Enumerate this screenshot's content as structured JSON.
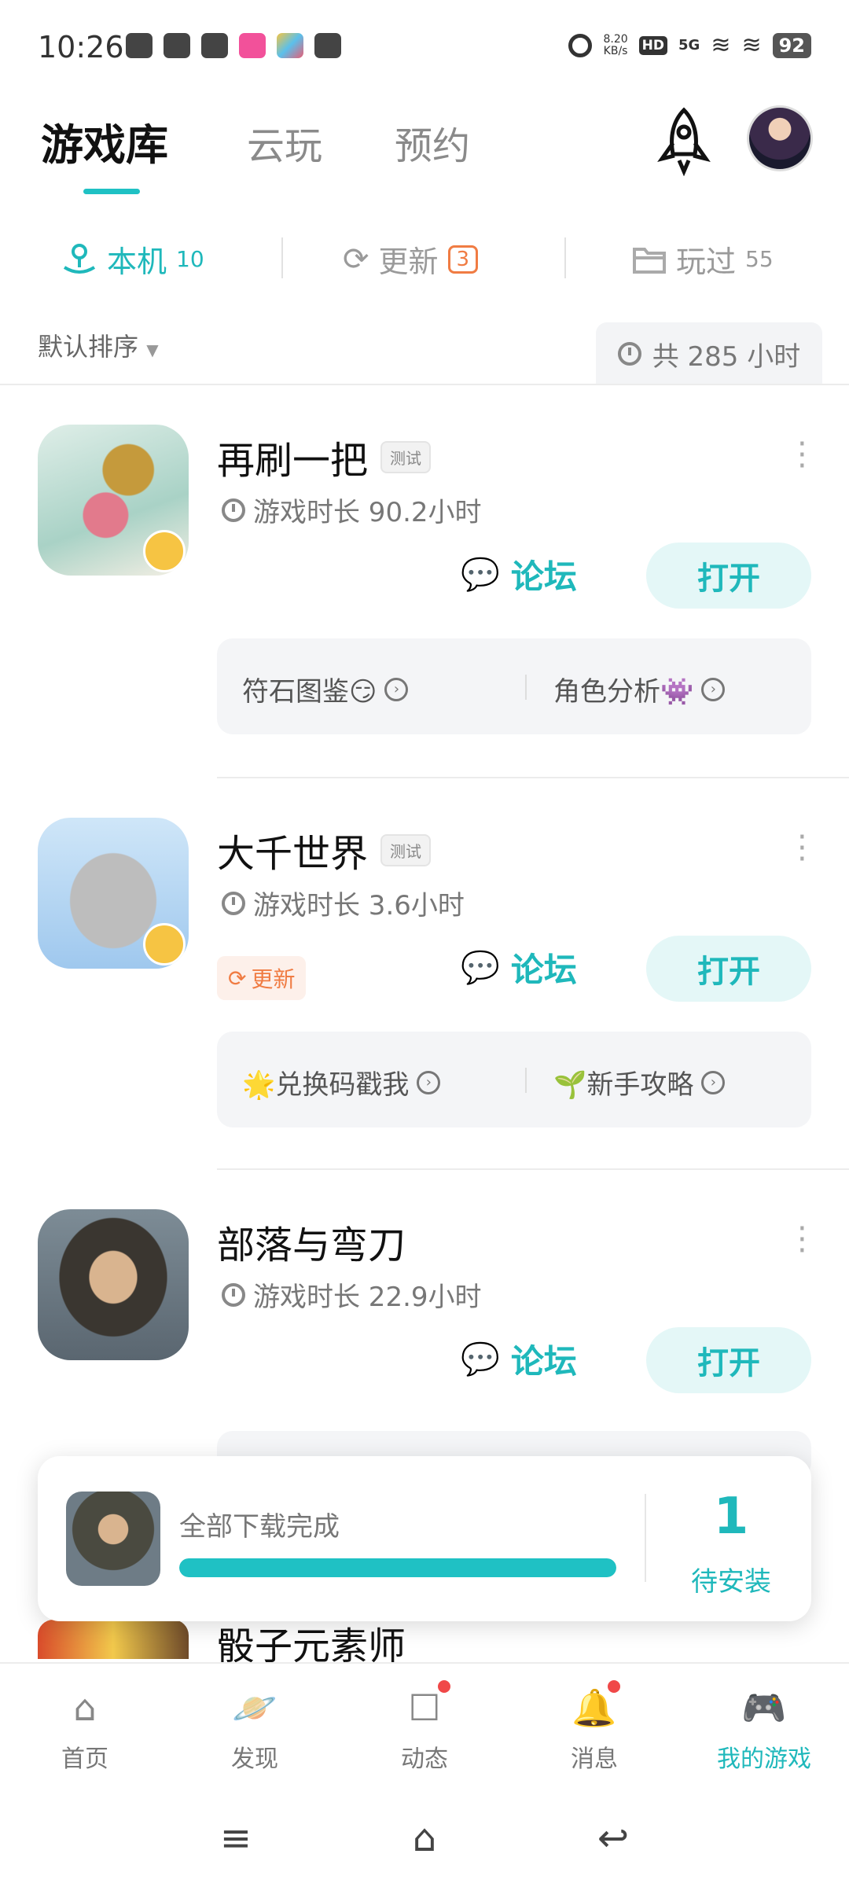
{
  "status": {
    "time": "10:26",
    "net_speed_value": "8.20",
    "net_speed_unit": "KB/s",
    "hd": "HD",
    "network": "5G",
    "battery": "92"
  },
  "header": {
    "tabs": [
      {
        "label": "游戏库",
        "active": true
      },
      {
        "label": "云玩",
        "active": false
      },
      {
        "label": "预约",
        "active": false
      }
    ],
    "rocket_icon": "rocket-icon",
    "avatar_icon": "user-avatar"
  },
  "subtabs": {
    "local": {
      "label": "本机",
      "count": "10"
    },
    "update": {
      "label": "更新",
      "count": "3"
    },
    "played": {
      "label": "玩过",
      "count": "55"
    }
  },
  "sort": {
    "label": "默认排序",
    "total_text": "共 285 小时"
  },
  "games": [
    {
      "title": "再刷一把",
      "tag": "测试",
      "playtime": "游戏时长 90.2小时",
      "forum": "论坛",
      "open": "打开",
      "links": [
        {
          "label": "符石图鉴😏"
        },
        {
          "label": "角色分析👾"
        }
      ]
    },
    {
      "title": "大千世界",
      "tag": "测试",
      "playtime": "游戏时长 3.6小时",
      "update_label": "更新",
      "forum": "论坛",
      "open": "打开",
      "links": [
        {
          "label": "🌟兑换码戳我"
        },
        {
          "label": "🌱新手攻略"
        }
      ]
    },
    {
      "title": "部落与弯刀",
      "playtime": "游戏时长 22.9小时",
      "forum": "论坛",
      "open": "打开"
    },
    {
      "title": "骰子元素师"
    }
  ],
  "download_popup": {
    "text": "全部下载完成",
    "progress": 1.0,
    "pending_count": "1",
    "pending_label": "待安装"
  },
  "bottom_nav": [
    {
      "label": "首页",
      "icon": "home-icon",
      "dot": false,
      "active": false
    },
    {
      "label": "发现",
      "icon": "planet-icon",
      "dot": false,
      "active": false
    },
    {
      "label": "动态",
      "icon": "message-board-icon",
      "dot": true,
      "active": false
    },
    {
      "label": "消息",
      "icon": "bell-icon",
      "dot": true,
      "active": false
    },
    {
      "label": "我的游戏",
      "icon": "gamepad-icon",
      "dot": false,
      "active": true
    }
  ],
  "colors": {
    "accent": "#1fb8bb",
    "update_orange": "#f07c43",
    "notification_red": "#f04848"
  }
}
